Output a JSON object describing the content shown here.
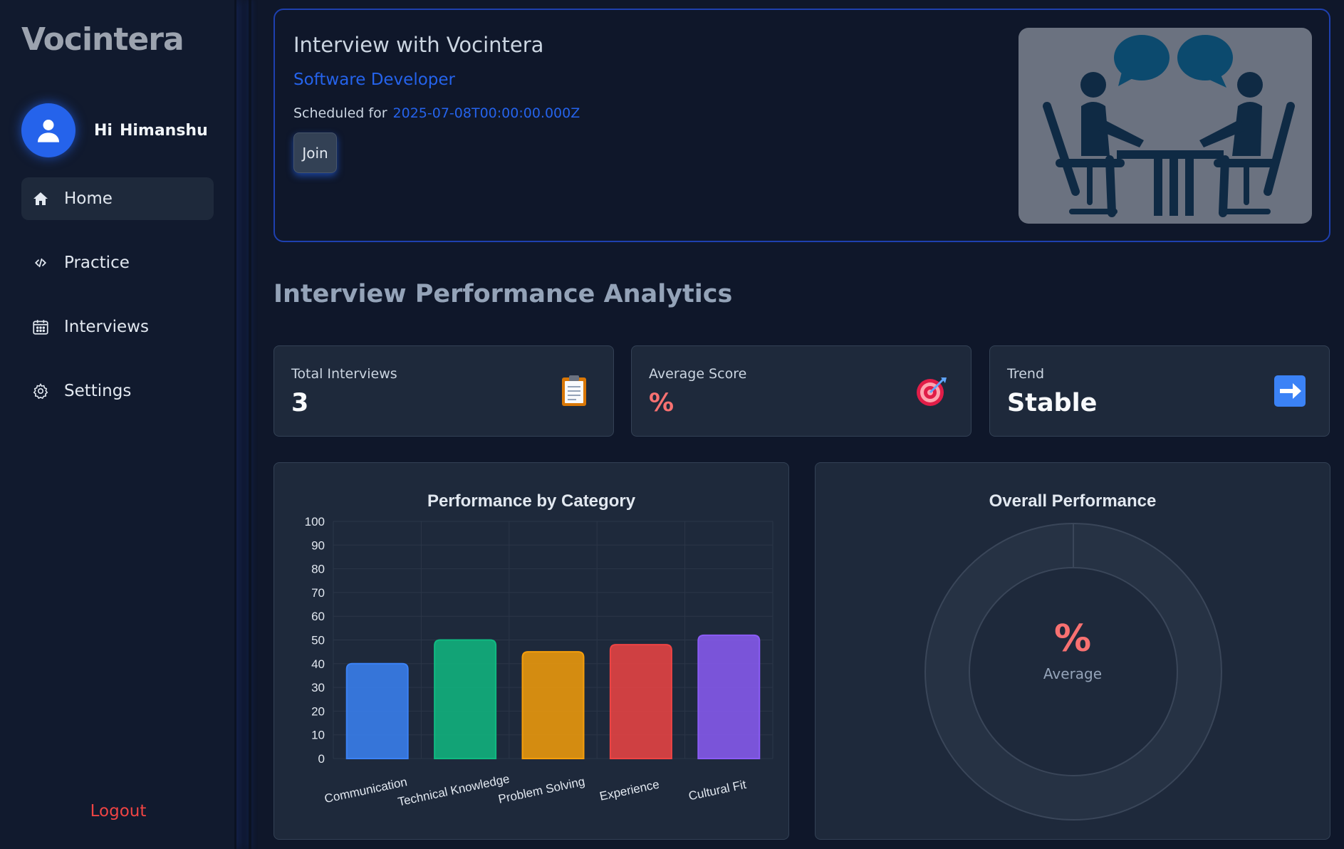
{
  "brand": "Vocintera",
  "user": {
    "greeting_prefix": "Hi",
    "name": "Himanshu"
  },
  "nav": [
    {
      "label": "Home",
      "icon": "home-icon",
      "active": true
    },
    {
      "label": "Practice",
      "icon": "code-icon",
      "active": false
    },
    {
      "label": "Interviews",
      "icon": "calendar-icon",
      "active": false
    },
    {
      "label": "Settings",
      "icon": "gear-icon",
      "active": false
    }
  ],
  "logout_label": "Logout",
  "hero": {
    "title": "Interview with Vocintera",
    "role": "Software Developer",
    "scheduled_label": "Scheduled for",
    "scheduled_date": "2025-07-08T00:00:00.000Z",
    "join_label": "Join"
  },
  "analytics_title": "Interview Performance Analytics",
  "stats": {
    "total": {
      "label": "Total Interviews",
      "value": "3",
      "icon": "clipboard-icon"
    },
    "average": {
      "label": "Average Score",
      "value": "%",
      "icon": "target-icon"
    },
    "trend": {
      "label": "Trend",
      "value": "Stable",
      "icon": "arrow-right-icon"
    }
  },
  "bar_panel_title": "Performance by Category",
  "donut_panel": {
    "title": "Overall Performance",
    "center_value": "%",
    "center_label": "Average"
  },
  "colors": {
    "accent": "#2563eb",
    "danger": "#f87171",
    "panel": "#1e293b"
  },
  "chart_data": [
    {
      "type": "bar",
      "title": "Performance by Category",
      "categories": [
        "Communication",
        "Technical Knowledge",
        "Problem Solving",
        "Experience",
        "Cultural Fit"
      ],
      "values": [
        40,
        50,
        45,
        48,
        52
      ],
      "colors": [
        "#3b82f6",
        "#10b981",
        "#f59e0b",
        "#ef4444",
        "#8b5cf6"
      ],
      "ylim": [
        0,
        100
      ],
      "yticks": [
        0,
        10,
        20,
        30,
        40,
        50,
        60,
        70,
        80,
        90,
        100
      ],
      "grid": true
    },
    {
      "type": "pie",
      "title": "Overall Performance",
      "values": [
        0
      ],
      "center_value": "%",
      "center_label": "Average"
    }
  ]
}
